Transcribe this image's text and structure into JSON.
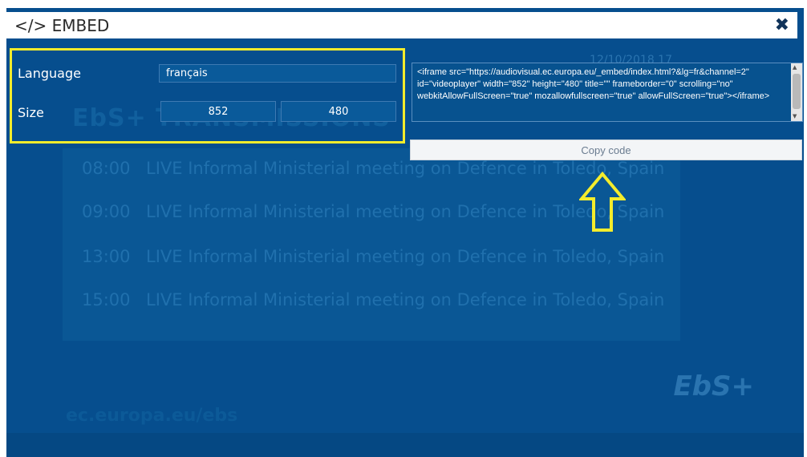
{
  "background": {
    "date": "12/10/2018 17",
    "heading": "EbS+ TRANSMISSIONS",
    "schedule": [
      {
        "time": "08:00",
        "text": "LIVE Informal Ministerial meeting on Defence in Toledo, Spain"
      },
      {
        "time": "09:00",
        "text": "LIVE Informal Ministerial meeting on Defence in Toledo, Spain"
      },
      {
        "time": "13:00",
        "text": "LIVE Informal Ministerial meeting on Defence in Toledo, Spain"
      },
      {
        "time": "15:00",
        "text": "LIVE Informal Ministerial meeting on Defence in Toledo, Spain"
      }
    ],
    "footer": "ec.europa.eu/ebs",
    "logo": "EbS+"
  },
  "modal": {
    "title": "</> EMBED",
    "close_icon": "close-icon"
  },
  "form": {
    "language_label": "Language",
    "language_value": "français",
    "size_label": "Size",
    "width_value": "852",
    "height_value": "480"
  },
  "embed_code": "<iframe src=\"https://audiovisual.ec.europa.eu/_embed/index.html?&lg=fr&channel=2\" id=\"videoplayer\" width=\"852\" height=\"480\" title=\"\" frameborder=\"0\" scrolling=\"no\" webkitAllowFullScreen=\"true\" mozallowfullscreen=\"true\" allowFullScreen=\"true\"></iframe>",
  "copy_button_label": "Copy code",
  "colors": {
    "background": "#064e8e",
    "highlight": "#f4ec2c",
    "header": "#ffffff"
  }
}
